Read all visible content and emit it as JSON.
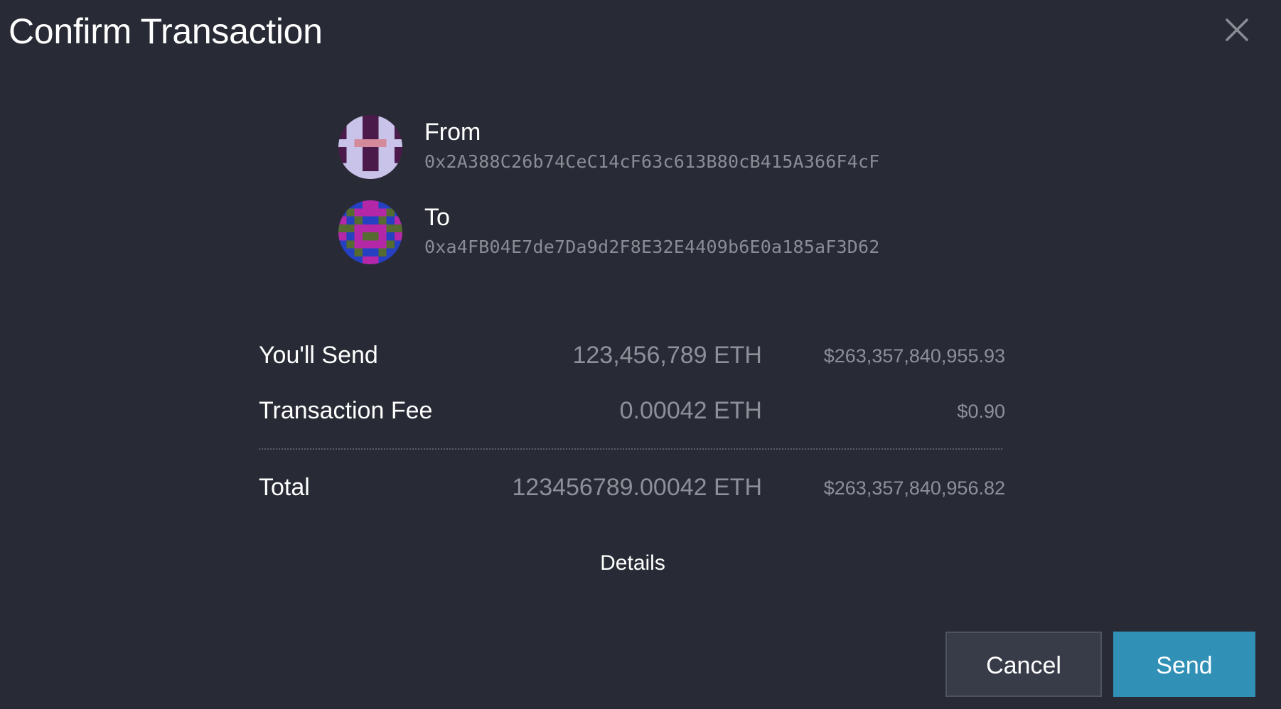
{
  "dialog": {
    "title": "Confirm Transaction",
    "close_icon": "close-icon"
  },
  "from": {
    "label": "From",
    "address": "0x2A388C26b74CeC14cF63c613B80cB415A366F4cF",
    "avatar_icon": "identicon-from",
    "avatar_colors": [
      "#4a1a4a",
      "#c9c3ea",
      "#d48a9a"
    ]
  },
  "to": {
    "label": "To",
    "address": "0xa4FB04E7de7Da9d2F8E32E4409b6E0a185aF3D62",
    "avatar_icon": "identicon-to",
    "avatar_colors": [
      "#2540c0",
      "#b428a8",
      "#556b2f"
    ]
  },
  "summary": {
    "send": {
      "label": "You'll Send",
      "amount": "123,456,789 ETH",
      "fiat": "$263,357,840,955.93"
    },
    "fee": {
      "label": "Transaction Fee",
      "amount": "0.00042 ETH",
      "fiat": "$0.90"
    },
    "total": {
      "label": "Total",
      "amount": "123456789.00042 ETH",
      "fiat": "$263,357,840,956.82"
    }
  },
  "details_label": "Details",
  "actions": {
    "cancel_label": "Cancel",
    "send_label": "Send"
  },
  "colors": {
    "background": "#282b35",
    "accent": "#3090b6",
    "secondary_button": "#383c49",
    "muted_text": "#8d9099"
  }
}
